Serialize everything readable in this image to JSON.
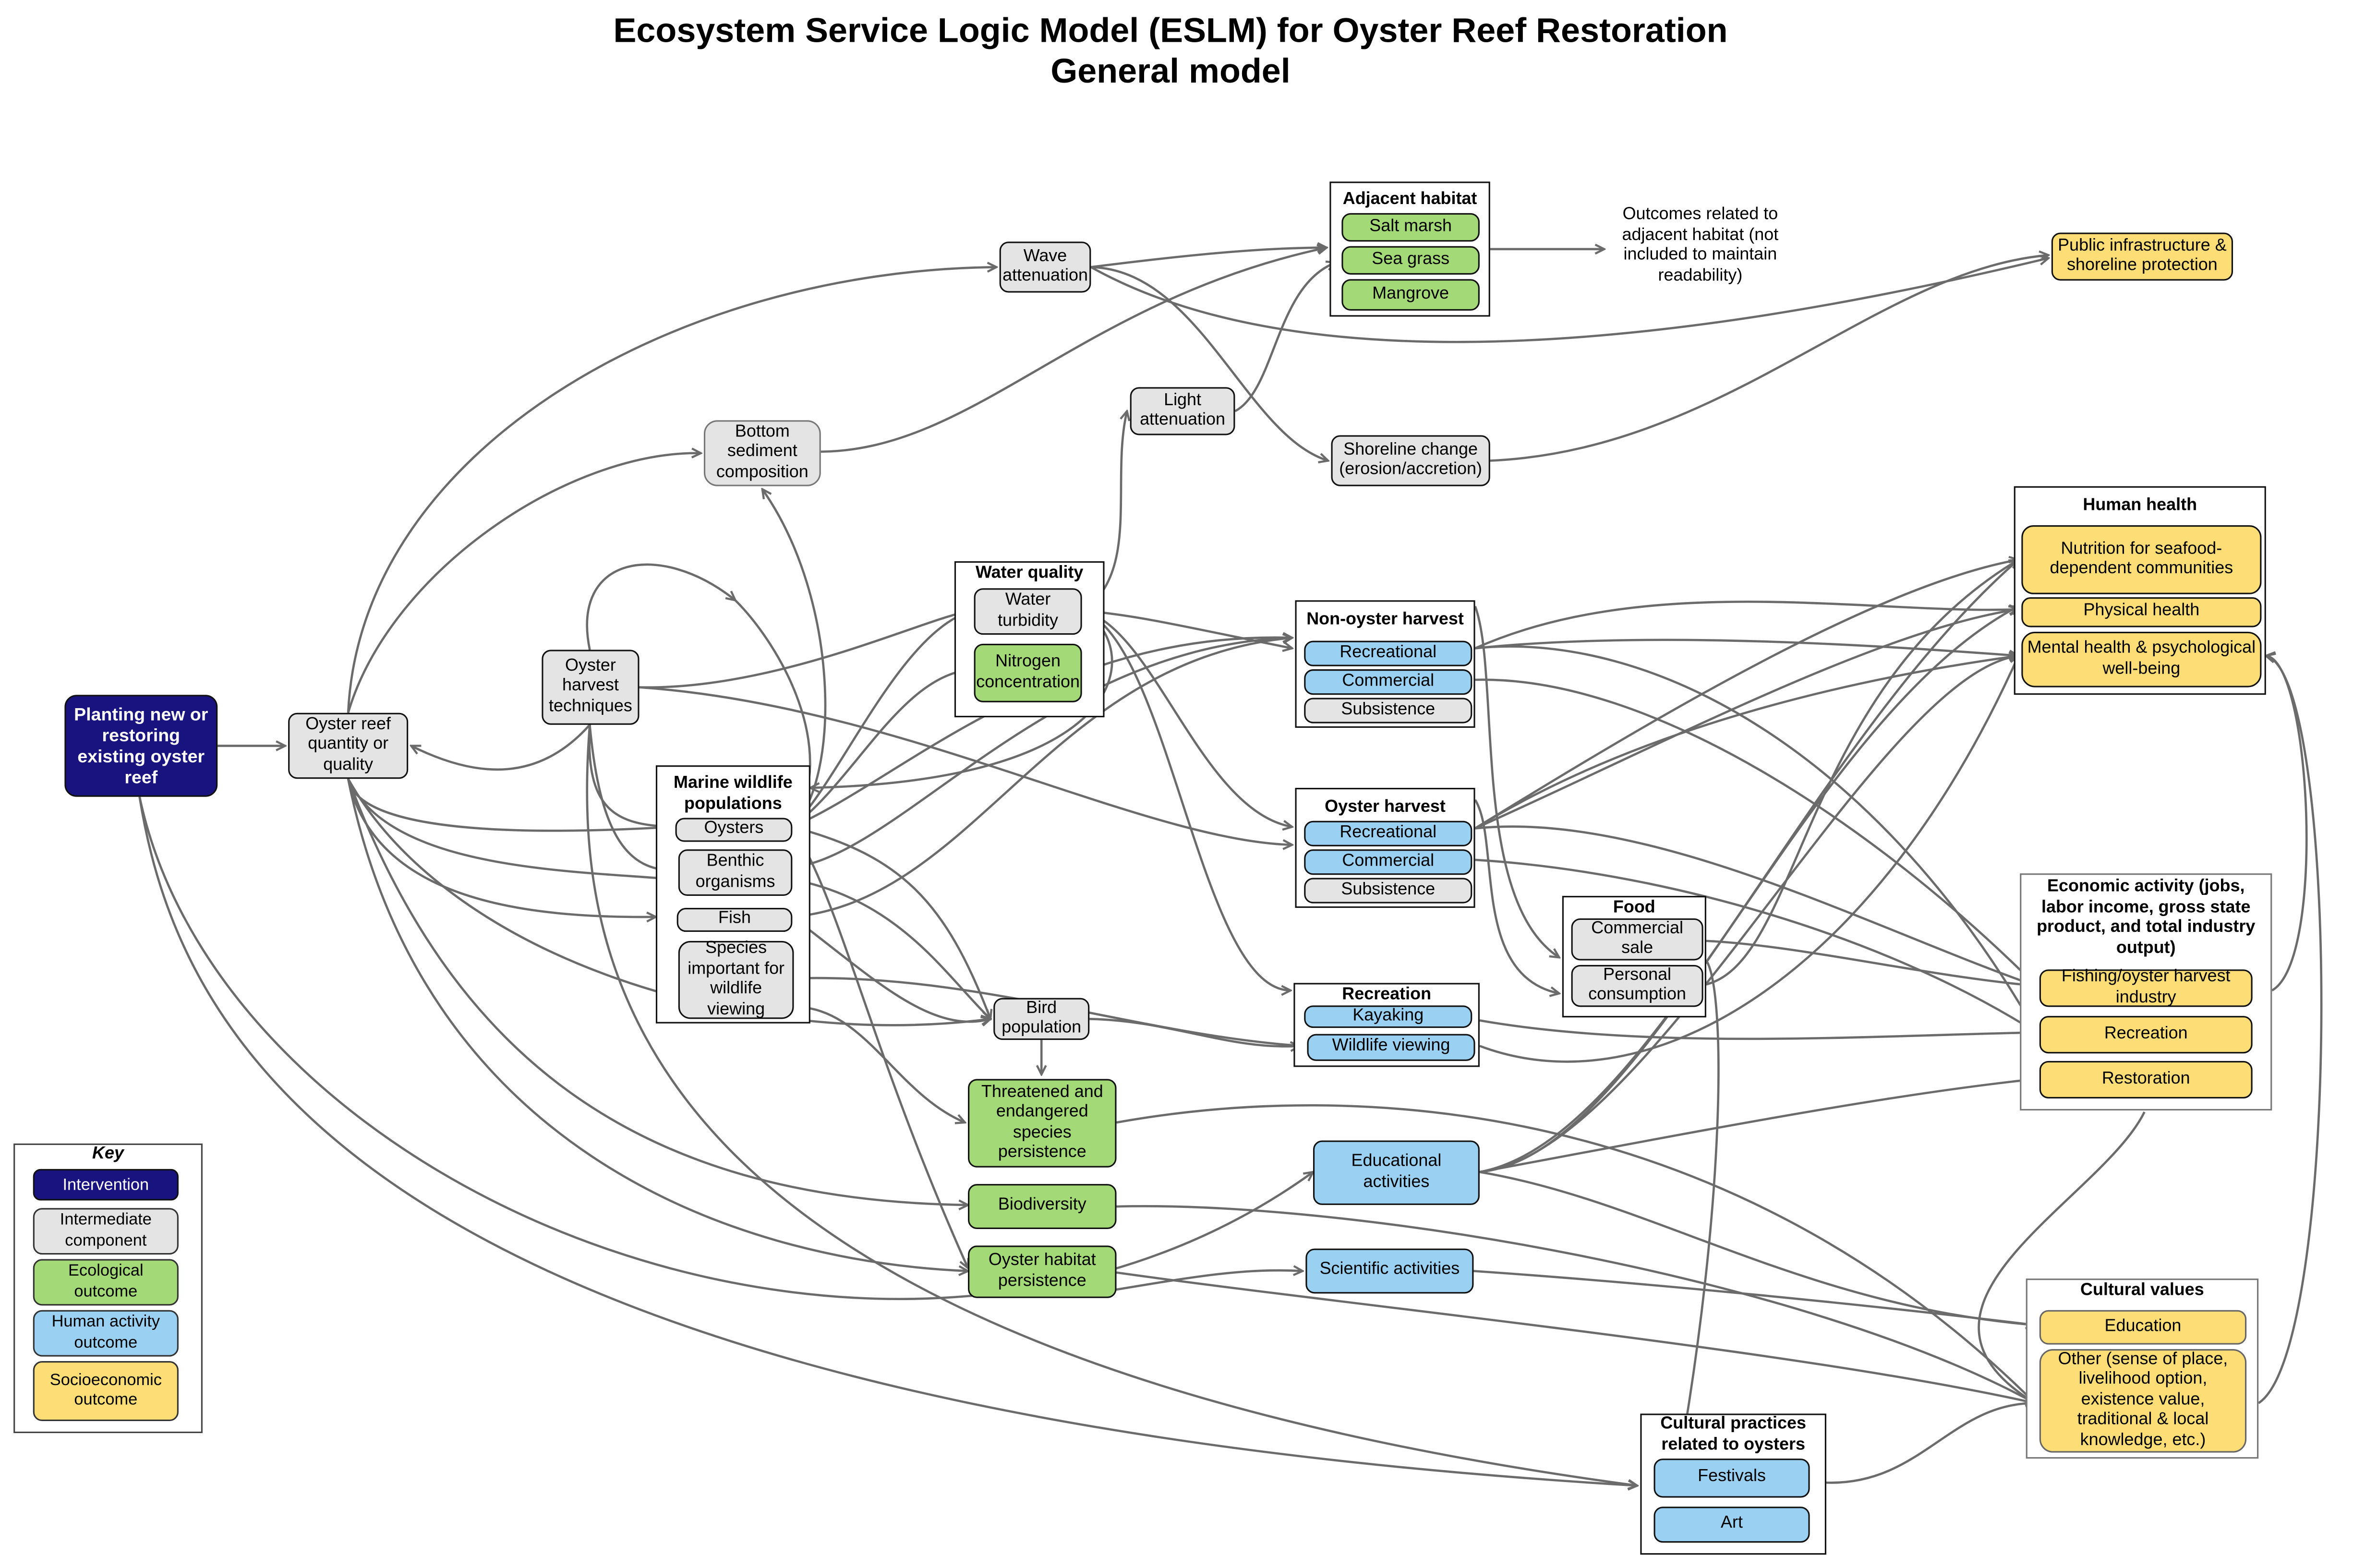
{
  "title": {
    "line1": "Ecosystem Service Logic Model (ESLM) for Oyster Reef Restoration",
    "line2": "General model"
  },
  "colors": {
    "intervention": "#19137f",
    "intermediate": "#e4e4e4",
    "ecological": "#a3d977",
    "human_activity": "#9ad0f1",
    "socioeconomic": "#fdde76",
    "edge": "#6b6b6b"
  },
  "nodes": {
    "planting": "Planting new or restoring existing oyster reef",
    "reef_quantity": "Oyster reef quantity or quality",
    "harvest_techniques": "Oyster harvest techniques",
    "bottom_sediment": "Bottom sediment composition",
    "wave_attenuation": "Wave attenuation",
    "light_attenuation": "Light attenuation",
    "shoreline_change": "Shoreline change (erosion/accretion)",
    "bird_population": "Bird population",
    "threatened_species": "Threatened and endangered species persistence",
    "biodiversity": "Biodiversity",
    "oyster_habitat": "Oyster habitat persistence",
    "educational_activities": "Educational activities",
    "scientific_activities": "Scientific activities",
    "public_infrastructure": "Public infrastructure & shoreline protection",
    "adjacent_note": "Outcomes related to adjacent habitat (not included to maintain readability)"
  },
  "groups": {
    "adjacent_habitat": {
      "title": "Adjacent habitat",
      "items": [
        "Salt marsh",
        "Sea grass",
        "Mangrove"
      ]
    },
    "water_quality": {
      "title": "Water quality",
      "items": [
        "Water turbidity",
        "Nitrogen concentration"
      ]
    },
    "marine_wildlife": {
      "title": "Marine wildlife populations",
      "items": [
        "Oysters",
        "Benthic organisms",
        "Fish",
        "Species important for wildlife viewing"
      ]
    },
    "non_oyster_harvest": {
      "title": "Non-oyster harvest",
      "items": [
        "Recreational",
        "Commercial",
        "Subsistence"
      ]
    },
    "oyster_harvest": {
      "title": "Oyster harvest",
      "items": [
        "Recreational",
        "Commercial",
        "Subsistence"
      ]
    },
    "recreation": {
      "title": "Recreation",
      "items": [
        "Kayaking",
        "Wildlife viewing"
      ]
    },
    "food": {
      "title": "Food",
      "items": [
        "Commercial sale",
        "Personal consumption"
      ]
    },
    "human_health": {
      "title": "Human health",
      "items": [
        "Nutrition for seafood-dependent communities",
        "Physical health",
        "Mental health & psychological well-being"
      ]
    },
    "economic_activity": {
      "title": "Economic activity (jobs, labor income, gross state product, and total industry output)",
      "items": [
        "Fishing/oyster harvest industry",
        "Recreation",
        "Restoration"
      ]
    },
    "cultural_values": {
      "title": "Cultural values",
      "items": [
        "Education",
        "Other (sense of place, livelihood option, existence value, traditional & local knowledge, etc.)"
      ]
    },
    "cultural_practices": {
      "title": "Cultural practices related to oysters",
      "items": [
        "Festivals",
        "Art"
      ]
    }
  },
  "key": {
    "title": "Key",
    "items": [
      "Intervention",
      "Intermediate component",
      "Ecological outcome",
      "Human activity outcome",
      "Socioeconomic outcome"
    ]
  }
}
